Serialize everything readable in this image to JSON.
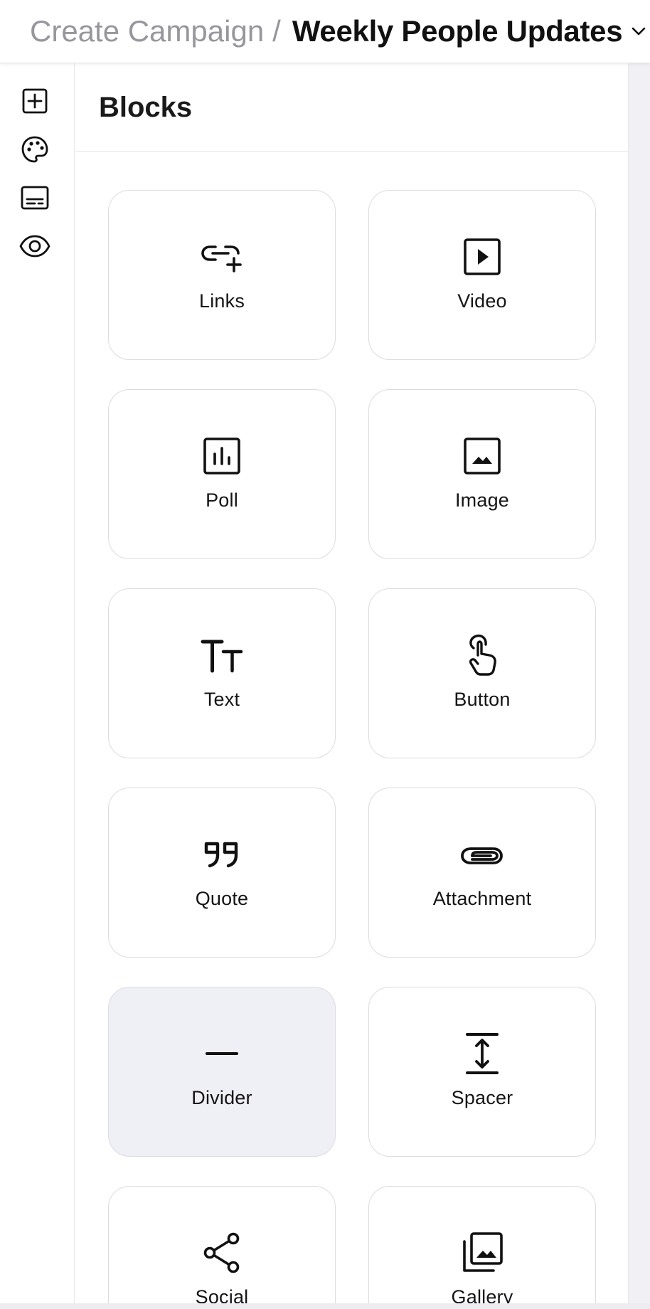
{
  "header": {
    "breadcrumb_parent": "Create Campaign",
    "breadcrumb_separator": "/",
    "breadcrumb_current": "Weekly People Updates"
  },
  "rail": {
    "items": [
      {
        "icon": "add-square-icon"
      },
      {
        "icon": "palette-icon"
      },
      {
        "icon": "layout-footer-icon"
      },
      {
        "icon": "eye-icon"
      }
    ]
  },
  "panel": {
    "title": "Blocks",
    "blocks": [
      {
        "label": "Links",
        "icon": "link-add-icon"
      },
      {
        "label": "Video",
        "icon": "video-icon"
      },
      {
        "label": "Poll",
        "icon": "poll-icon"
      },
      {
        "label": "Image",
        "icon": "image-icon"
      },
      {
        "label": "Text",
        "icon": "text-size-icon"
      },
      {
        "label": "Button",
        "icon": "hand-pointer-icon"
      },
      {
        "label": "Quote",
        "icon": "quote-icon"
      },
      {
        "label": "Attachment",
        "icon": "paperclip-icon"
      },
      {
        "label": "Divider",
        "icon": "divider-icon",
        "active": true
      },
      {
        "label": "Spacer",
        "icon": "spacer-icon"
      },
      {
        "label": "Social",
        "icon": "share-icon"
      },
      {
        "label": "Gallery",
        "icon": "gallery-icon"
      }
    ]
  },
  "colors": {
    "active_card_bg": "#efeff6",
    "card_border": "#dcdce2",
    "breadcrumb_muted": "#96969c"
  }
}
